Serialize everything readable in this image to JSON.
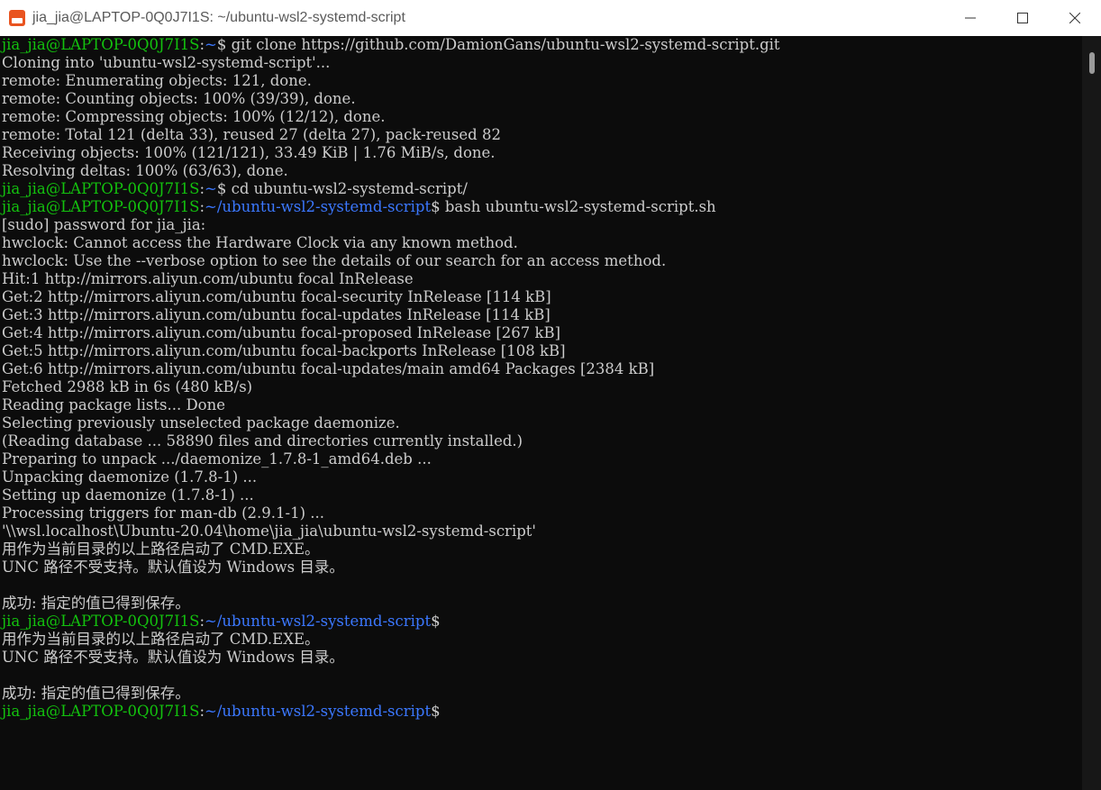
{
  "window": {
    "title": "jia_jia@LAPTOP-0Q0J7I1S: ~/ubuntu-wsl2-systemd-script",
    "app_icon": "ubuntu-terminal-icon",
    "controls": [
      "minimize-icon",
      "maximize-icon",
      "close-icon"
    ]
  },
  "colors": {
    "user_host": "#13c10e",
    "path": "#3b78ff",
    "text": "#cccccc",
    "background": "#0c0c0c"
  },
  "terminal": {
    "lines": [
      {
        "user": "jia_jia@LAPTOP-0Q0J7I1S",
        "path": "~",
        "text": "$ git clone https://github.com/DamionGans/ubuntu-wsl2-systemd-script.git"
      },
      {
        "text": "Cloning into 'ubuntu-wsl2-systemd-script'..."
      },
      {
        "text": "remote: Enumerating objects: 121, done."
      },
      {
        "text": "remote: Counting objects: 100% (39/39), done."
      },
      {
        "text": "remote: Compressing objects: 100% (12/12), done."
      },
      {
        "text": "remote: Total 121 (delta 33), reused 27 (delta 27), pack-reused 82"
      },
      {
        "text": "Receiving objects: 100% (121/121), 33.49 KiB | 1.76 MiB/s, done."
      },
      {
        "text": "Resolving deltas: 100% (63/63), done."
      },
      {
        "user": "jia_jia@LAPTOP-0Q0J7I1S",
        "path": "~",
        "text": "$ cd ubuntu-wsl2-systemd-script/"
      },
      {
        "user": "jia_jia@LAPTOP-0Q0J7I1S",
        "path": "~/ubuntu-wsl2-systemd-script",
        "text": "$ bash ubuntu-wsl2-systemd-script.sh"
      },
      {
        "text": "[sudo] password for jia_jia:"
      },
      {
        "text": "hwclock: Cannot access the Hardware Clock via any known method."
      },
      {
        "text": "hwclock: Use the --verbose option to see the details of our search for an access method."
      },
      {
        "text": "Hit:1 http://mirrors.aliyun.com/ubuntu focal InRelease"
      },
      {
        "text": "Get:2 http://mirrors.aliyun.com/ubuntu focal-security InRelease [114 kB]"
      },
      {
        "text": "Get:3 http://mirrors.aliyun.com/ubuntu focal-updates InRelease [114 kB]"
      },
      {
        "text": "Get:4 http://mirrors.aliyun.com/ubuntu focal-proposed InRelease [267 kB]"
      },
      {
        "text": "Get:5 http://mirrors.aliyun.com/ubuntu focal-backports InRelease [108 kB]"
      },
      {
        "text": "Get:6 http://mirrors.aliyun.com/ubuntu focal-updates/main amd64 Packages [2384 kB]"
      },
      {
        "text": "Fetched 2988 kB in 6s (480 kB/s)"
      },
      {
        "text": "Reading package lists... Done"
      },
      {
        "text": "Selecting previously unselected package daemonize."
      },
      {
        "text": "(Reading database ... 58890 files and directories currently installed.)"
      },
      {
        "text": "Preparing to unpack .../daemonize_1.7.8-1_amd64.deb ..."
      },
      {
        "text": "Unpacking daemonize (1.7.8-1) ..."
      },
      {
        "text": "Setting up daemonize (1.7.8-1) ..."
      },
      {
        "text": "Processing triggers for man-db (2.9.1-1) ..."
      },
      {
        "text": "'\\\\wsl.localhost\\Ubuntu-20.04\\home\\jia_jia\\ubuntu-wsl2-systemd-script'"
      },
      {
        "text": "用作为当前目录的以上路径启动了 CMD.EXE。"
      },
      {
        "text": "UNC 路径不受支持。默认值设为 Windows 目录。"
      },
      {
        "text": ""
      },
      {
        "text": "成功: 指定的值已得到保存。"
      },
      {
        "user": "jia_jia@LAPTOP-0Q0J7I1S",
        "path": "~/ubuntu-wsl2-systemd-script",
        "text": "$"
      },
      {
        "text": "用作为当前目录的以上路径启动了 CMD.EXE。"
      },
      {
        "text": "UNC 路径不受支持。默认值设为 Windows 目录。"
      },
      {
        "text": ""
      },
      {
        "text": "成功: 指定的值已得到保存。"
      },
      {
        "user": "jia_jia@LAPTOP-0Q0J7I1S",
        "path": "~/ubuntu-wsl2-systemd-script",
        "text": "$"
      }
    ]
  }
}
